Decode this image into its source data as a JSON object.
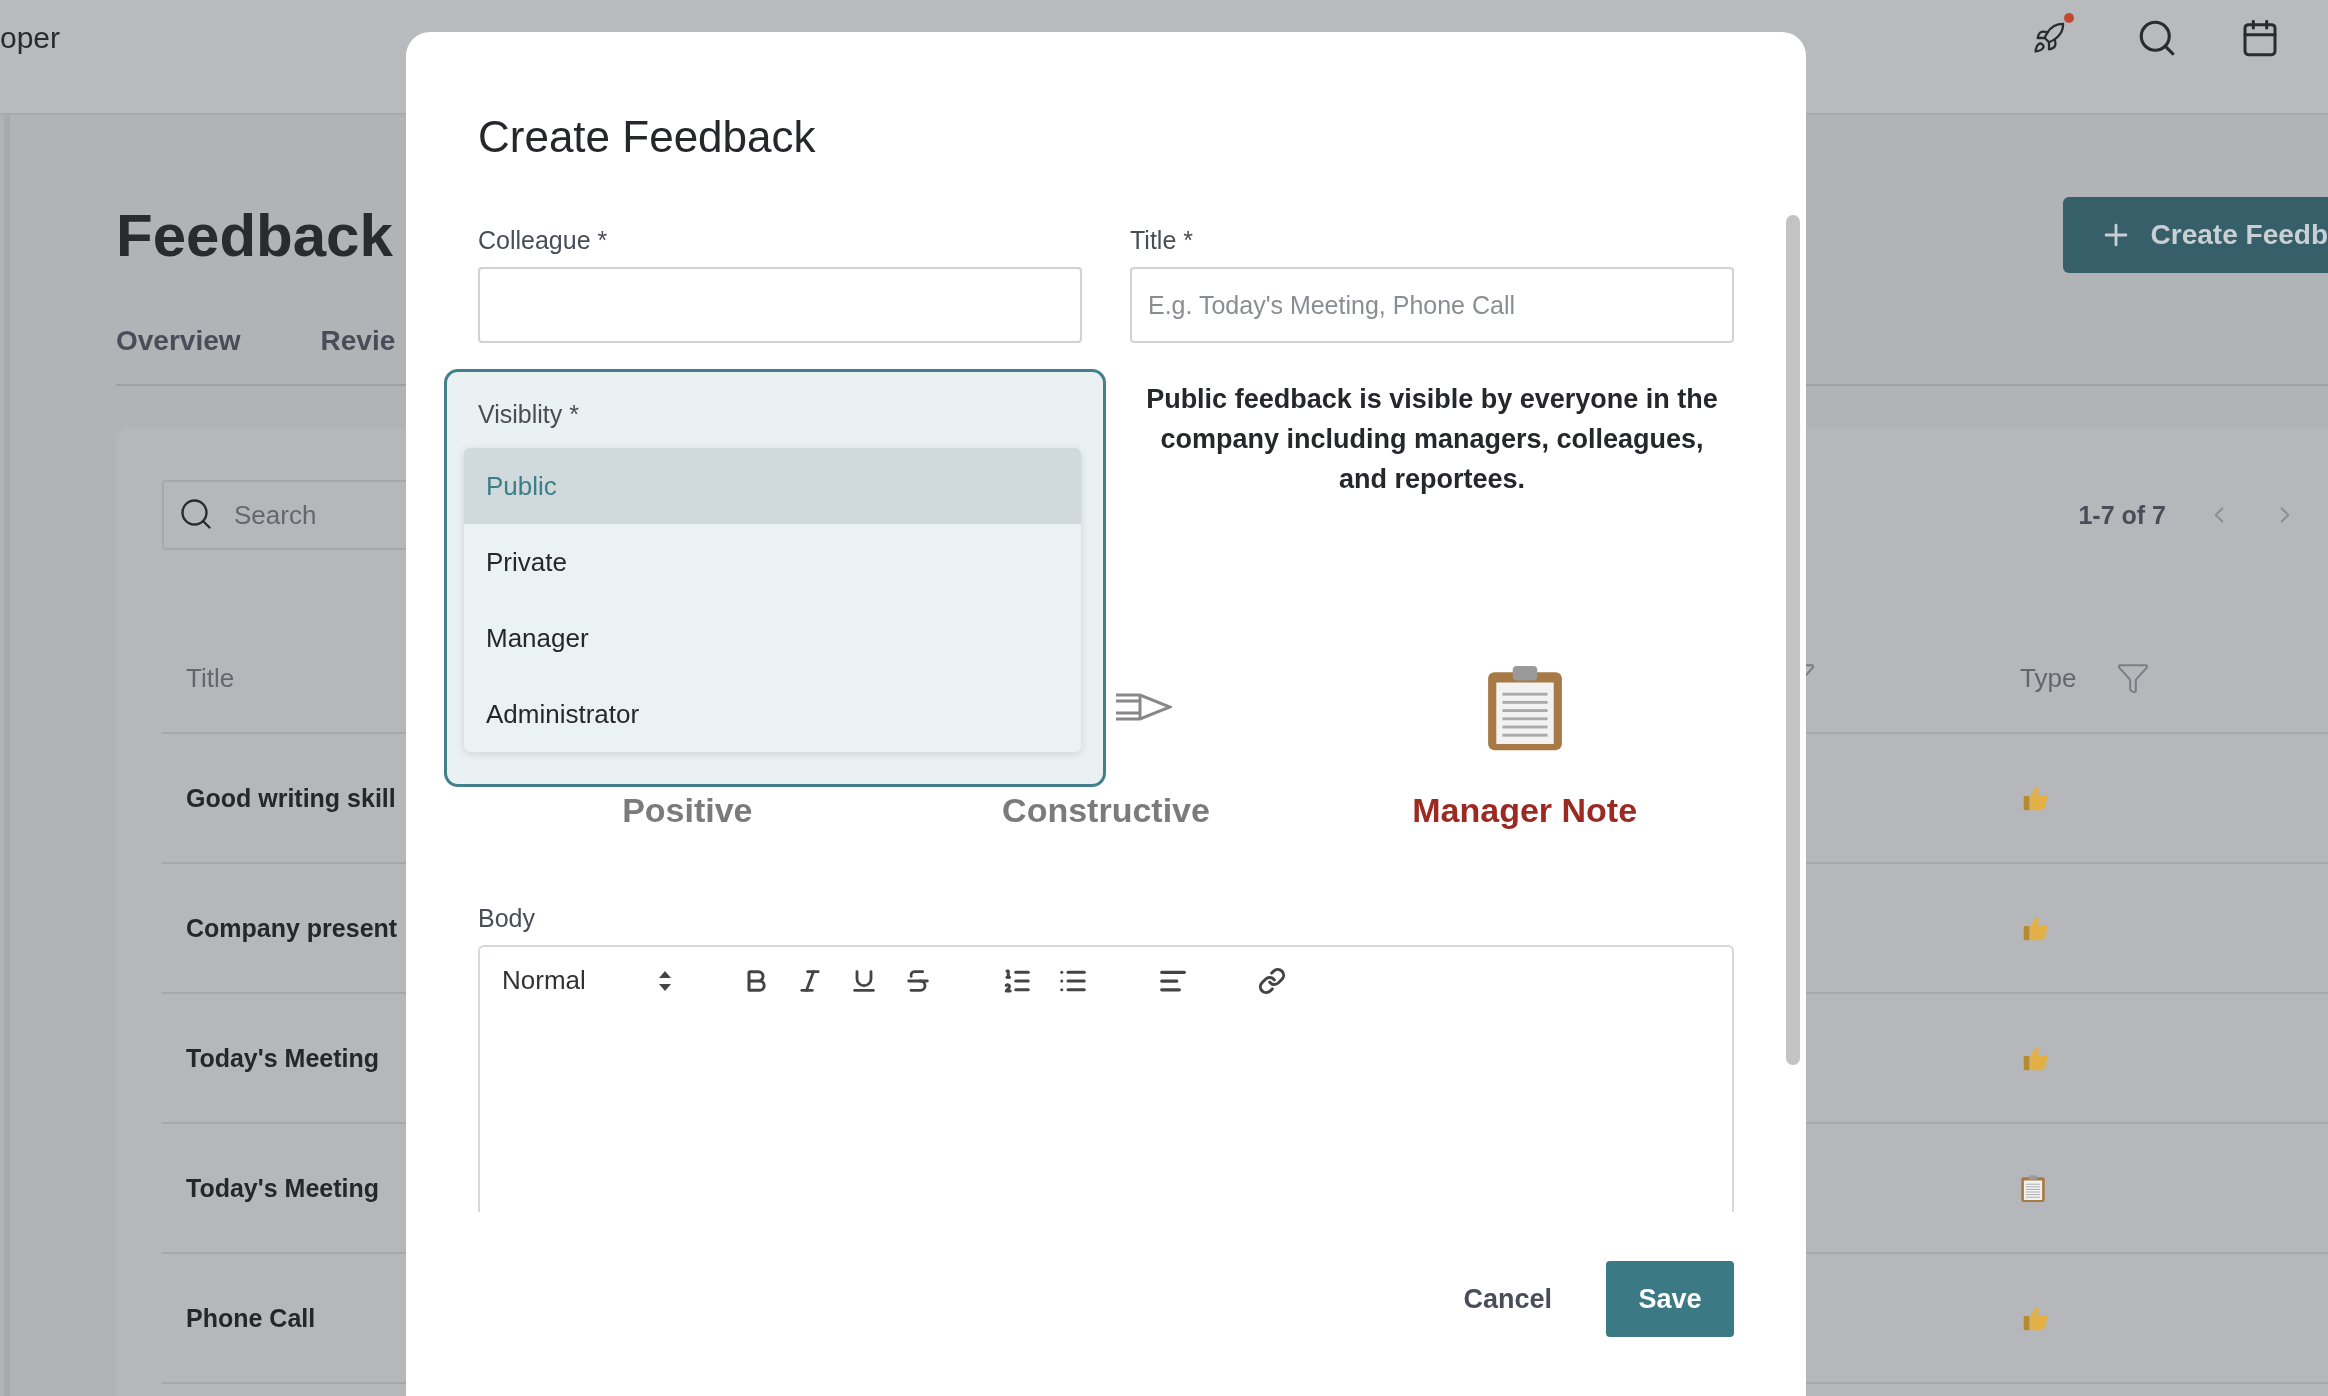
{
  "app": {
    "brand": "oper"
  },
  "page": {
    "title": "Feedback",
    "create_button": "Create Feedb",
    "tabs": [
      {
        "label": "Overview",
        "selected": false
      },
      {
        "label": "Revie",
        "selected": false
      }
    ]
  },
  "search": {
    "placeholder": "Search"
  },
  "pagination": {
    "range": "1-7 of 7"
  },
  "table": {
    "columns": [
      "Title",
      "Type"
    ],
    "rows": [
      {
        "title": "Good writing skill",
        "kind": "positive"
      },
      {
        "title": "Company present",
        "kind": "positive"
      },
      {
        "title": "Today's Meeting",
        "kind": "positive"
      },
      {
        "title": "Today's Meeting",
        "kind": "manager_note"
      },
      {
        "title": "Phone Call",
        "kind": "positive"
      }
    ]
  },
  "modal": {
    "title": "Create Feedback",
    "fields": [
      {
        "label": "Colleague *"
      },
      {
        "label": "Title *",
        "placeholder": "E.g. Today's Meeting, Phone Call"
      }
    ],
    "visibility": {
      "label": "Visiblity *",
      "options": [
        {
          "label": "Public",
          "selected": true
        },
        {
          "label": "Private",
          "selected": false
        },
        {
          "label": "Manager",
          "selected": false
        },
        {
          "label": "Administrator",
          "selected": false
        }
      ],
      "description": "Public feedback is visible by everyone in the company including managers, colleagues, and reportees."
    },
    "types": [
      {
        "label": "Positive",
        "kind": "positive",
        "selected": false
      },
      {
        "label": "Constructive",
        "kind": "constructive",
        "selected": false
      },
      {
        "label": "Manager Note",
        "kind": "manager_note",
        "selected": true
      }
    ],
    "body": {
      "label": "Body",
      "format": "Normal"
    },
    "cancel": "Cancel",
    "save": "Save"
  }
}
